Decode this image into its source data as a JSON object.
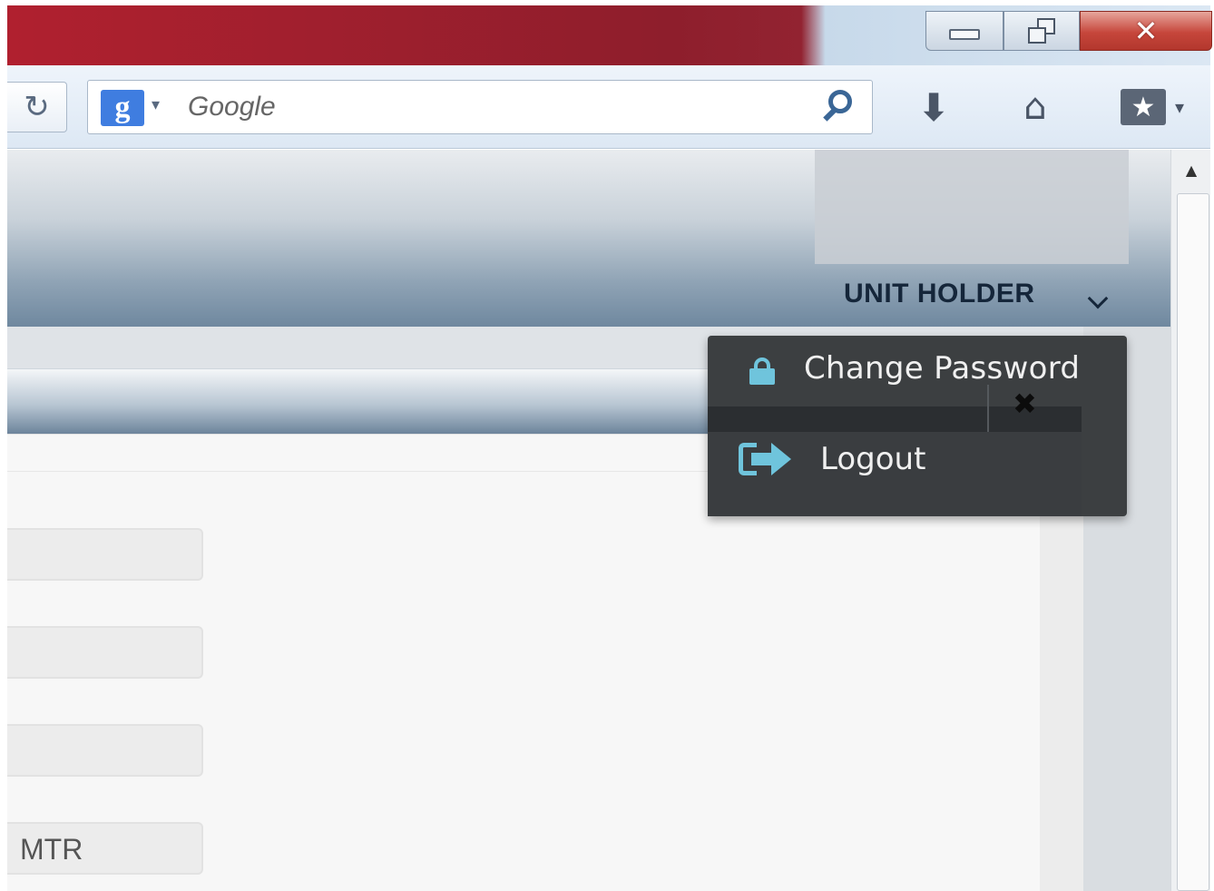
{
  "browser": {
    "search": {
      "placeholder": "Google"
    },
    "window_controls": {
      "close_glyph": "✕"
    },
    "icons": [
      "reload-icon",
      "google-logo-icon",
      "search-icon",
      "download-icon",
      "home-icon",
      "bookmarks-icon"
    ]
  },
  "header": {
    "user_menu_label": "UNIT HOLDER"
  },
  "dropdown": {
    "items": [
      {
        "label": "Change Password",
        "icon": "lock-icon"
      },
      {
        "label": "Logout",
        "icon": "logout-icon"
      }
    ],
    "close_glyph": "✖"
  },
  "form": {
    "fields": [
      {
        "value": ""
      },
      {
        "value": ""
      },
      {
        "value": ""
      },
      {
        "value": "MTR"
      }
    ]
  },
  "colors": {
    "accent": "#6fc4dc",
    "menu_bg": "#3c3f41",
    "header_text": "#15263a"
  }
}
